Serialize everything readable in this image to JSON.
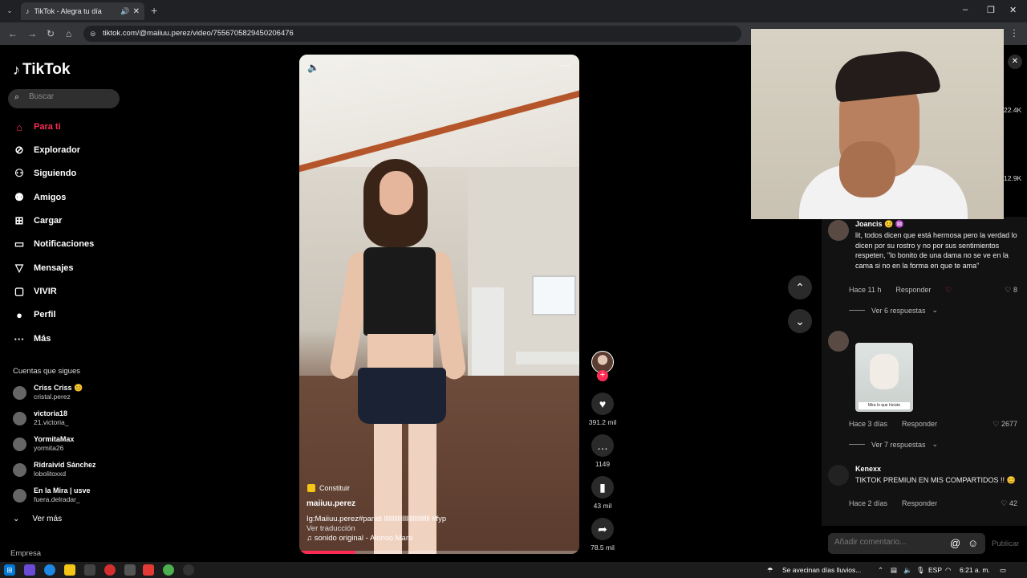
{
  "browser": {
    "tab_title": "TikTok - Alegra tu día",
    "url": "tiktok.com/@maiiuu.perez/video/7556705829450206476"
  },
  "sidebar": {
    "logo": "TikTok",
    "search_placeholder": "Buscar",
    "nav": [
      {
        "label": "Para ti",
        "icon": "home-icon",
        "active": true
      },
      {
        "label": "Explorador",
        "icon": "compass-icon"
      },
      {
        "label": "Siguiendo",
        "icon": "following-icon"
      },
      {
        "label": "Amigos",
        "icon": "friends-icon"
      },
      {
        "label": "Cargar",
        "icon": "upload-icon"
      },
      {
        "label": "Notificaciones",
        "icon": "inbox-icon"
      },
      {
        "label": "Mensajes",
        "icon": "messages-icon"
      },
      {
        "label": "VIVIR",
        "icon": "live-icon"
      },
      {
        "label": "Perfil",
        "icon": "profile-avatar"
      },
      {
        "label": "Más",
        "icon": "more-icon"
      }
    ],
    "following_title": "Cuentas que sigues",
    "accounts": [
      {
        "name": "Criss Criss 😊",
        "handle": "cristal.perez"
      },
      {
        "name": "victoria18",
        "handle": "21.victoria_"
      },
      {
        "name": "YormitaMax",
        "handle": "yormita26"
      },
      {
        "name": "Ridraivid Sánchez",
        "handle": "lobolitoxxd"
      },
      {
        "name": "En la Mira | usve",
        "handle": "fuera.delradar_"
      }
    ],
    "see_more": "Ver más",
    "footer": "Empresa"
  },
  "video": {
    "contribute": "Constituir",
    "author": "maiiuu.perez",
    "caption": "Ig:Maiiuu.perez#parati lllllllllllllllllllllllllll #fyp",
    "translate": "Ver traducción",
    "music": "sonido original - Alonso Mare",
    "progress": 0.2
  },
  "actions": {
    "likes": "391.2 mil",
    "comments": "1149",
    "saves": "43 mil",
    "shares": "78.5 mil"
  },
  "side_counts": [
    "22.4K",
    "12.9K"
  ],
  "comments": [
    {
      "user": "Joancis 😊 ♒",
      "text": "lit, todos dicen que está hermosa pero la verdad lo dicen por su rostro y no por sus sentimientos respeten, \"lo bonito de una dama no se ve en la cama si no en la forma en que te ama\"",
      "time": "Hace 11 h",
      "reply": "Responder",
      "likes": "8",
      "replies": "Ver 6 respuestas"
    },
    {
      "user": "",
      "sticker_label": "Mira lo que hiciste",
      "time": "Hace 3 días",
      "reply": "Responder",
      "likes": "2677",
      "replies": "Ver 7 respuestas"
    },
    {
      "user": "Kenexx",
      "text": "TIKTOK PREMIUN EN MIS COMPARTIDOS !! 😊",
      "time": "Hace 2 días",
      "reply": "Responder",
      "likes": "42"
    }
  ],
  "comment_input_placeholder": "Añadir comentario...",
  "publish": "Publicar",
  "taskbar": {
    "weather": "Se avecinan días lluvios...",
    "lang": "ESP",
    "time": "6:21 a. m."
  }
}
